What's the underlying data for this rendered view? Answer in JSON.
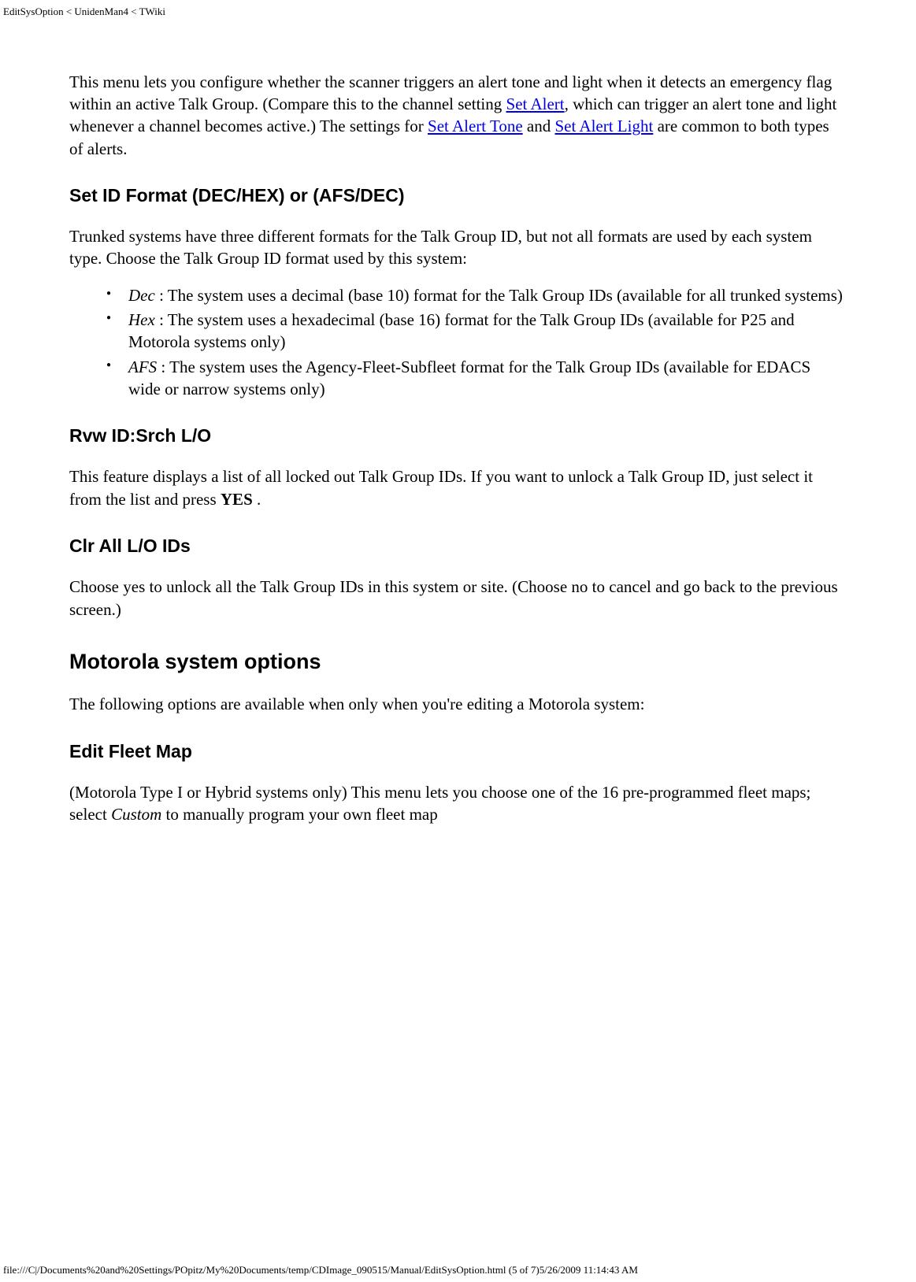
{
  "header": "EditSysOption < UnidenMan4 < TWiki",
  "intro": {
    "part1": "This menu lets you configure whether the scanner triggers an alert tone and light when it detects an emergency flag within an active Talk Group. (Compare this to the channel setting ",
    "link1": "Set Alert",
    "part2": ", which can trigger an alert tone and light whenever a channel becomes active.) The settings for ",
    "link2": "Set Alert Tone",
    "part3": " and ",
    "link3": "Set Alert Light",
    "part4": " are common to both types of alerts."
  },
  "h_setid": "Set ID Format (DEC/HEX) or (AFS/DEC)",
  "setid_intro": "Trunked systems have three different formats for the Talk Group ID, but not all formats are used by each system type. Choose the Talk Group ID format used by this system:",
  "formats": {
    "dec_label": "Dec",
    "dec_text": " : The system uses a decimal (base 10) format for the Talk Group IDs (available for all trunked systems)",
    "hex_label": "Hex",
    "hex_text": " : The system uses a hexadecimal (base 16) format for the Talk Group IDs (available for P25 and Motorola systems only)",
    "afs_label": "AFS",
    "afs_text": " : The system uses the Agency-Fleet-Subfleet format for the Talk Group IDs (available for EDACS wide or narrow systems only)"
  },
  "h_rvw": "Rvw ID:Srch L/O",
  "rvw_text1": "This feature displays a list of all locked out Talk Group IDs. If you want to unlock a Talk Group ID, just select it from the list and press ",
  "rvw_yes": "YES",
  "rvw_text2": " .",
  "h_clr": "Clr All L/O IDs",
  "clr_text": "Choose yes to unlock all the Talk Group IDs in this system or site. (Choose no to cancel and go back to the previous screen.)",
  "h_moto": "Motorola system options",
  "moto_intro": "The following options are available when only when you're editing a Motorola system:",
  "h_fleet": "Edit Fleet Map",
  "fleet_text1": "(Motorola Type I or Hybrid systems only) This menu lets you choose one of the 16 pre-programmed fleet maps; select ",
  "fleet_custom": "Custom",
  "fleet_text2": " to manually program your own fleet map",
  "footer": "file:///C|/Documents%20and%20Settings/POpitz/My%20Documents/temp/CDImage_090515/Manual/EditSysOption.html (5 of 7)5/26/2009 11:14:43 AM"
}
